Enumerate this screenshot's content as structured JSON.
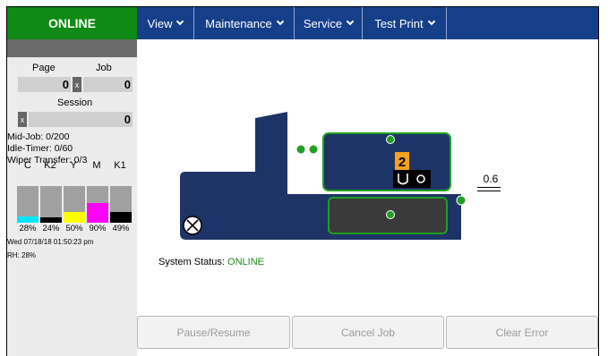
{
  "status_tab": {
    "label": "ONLINE"
  },
  "nav": {
    "items": [
      {
        "label": "View"
      },
      {
        "label": "Maintenance"
      },
      {
        "label": "Service"
      },
      {
        "label": "Test Print"
      }
    ]
  },
  "counters": {
    "page_label": "Page",
    "job_label": "Job",
    "page_value": "0",
    "job_value": "0",
    "session_label": "Session",
    "session_value": "0",
    "reset_glyph": "x"
  },
  "info": {
    "mid_job": "Mid-Job: 0/200",
    "idle_timer": "Idle-Timer: 0/60",
    "wiper_transfer": "Wiper Transfer: 0/3"
  },
  "inks": [
    {
      "name": "C",
      "percent": "28%",
      "level": 0.28,
      "color": "#00e5ff"
    },
    {
      "name": "K2",
      "percent": "24%",
      "level": 0.24,
      "color": "#000000"
    },
    {
      "name": "Y",
      "percent": "50%",
      "level": 0.5,
      "color": "#ffff00"
    },
    {
      "name": "M",
      "percent": "90%",
      "level": 0.9,
      "color": "#ff00ff"
    },
    {
      "name": "K1",
      "percent": "49%",
      "level": 0.49,
      "color": "#000000"
    }
  ],
  "datetime": "Wed 07/18/18 01:50:23 pm",
  "humidity": "RH: 28%",
  "diagram": {
    "head_number": "2",
    "measurement": "0.6"
  },
  "system_status": {
    "label": "System Status:",
    "value": "ONLINE"
  },
  "buttons": {
    "pause_resume": "Pause/Resume",
    "cancel_job": "Cancel Job",
    "clear_error": "Clear Error"
  },
  "colors": {
    "online_green": "#0f8a14",
    "nav_blue": "#163f8a",
    "machine_navy": "#1e3466",
    "indicator_green": "#1fa01f"
  }
}
